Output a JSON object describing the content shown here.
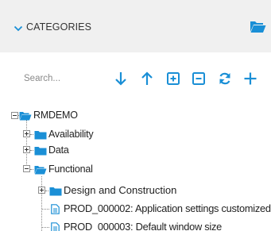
{
  "header": {
    "title": "CATEGORIES",
    "chevron_icon": "chevron-down-icon",
    "folder_icon": "folder-open-icon",
    "accent": "#1a8fd6"
  },
  "toolbar": {
    "search_placeholder": "Search...",
    "tools": [
      {
        "name": "move-down",
        "icon": "arrow-down-icon"
      },
      {
        "name": "move-up",
        "icon": "arrow-up-icon"
      },
      {
        "name": "expand-all",
        "icon": "plus-square-icon"
      },
      {
        "name": "collapse-all",
        "icon": "minus-square-icon"
      },
      {
        "name": "refresh",
        "icon": "refresh-icon"
      },
      {
        "name": "add",
        "icon": "plus-icon"
      }
    ]
  },
  "tree": {
    "root": "RMDEMO",
    "nodes": [
      {
        "label": "Availability",
        "type": "folder",
        "expander": "plus"
      },
      {
        "label": "Data",
        "type": "folder",
        "expander": "plus"
      },
      {
        "label": "Functional",
        "type": "folder-open",
        "expander": "minus"
      },
      {
        "label": "Design and Construction",
        "type": "folder",
        "expander": "plus"
      },
      {
        "label": "PROD_000002: Application settings customized",
        "type": "document"
      },
      {
        "label": "PROD_000003: Default window size",
        "type": "document"
      }
    ]
  }
}
